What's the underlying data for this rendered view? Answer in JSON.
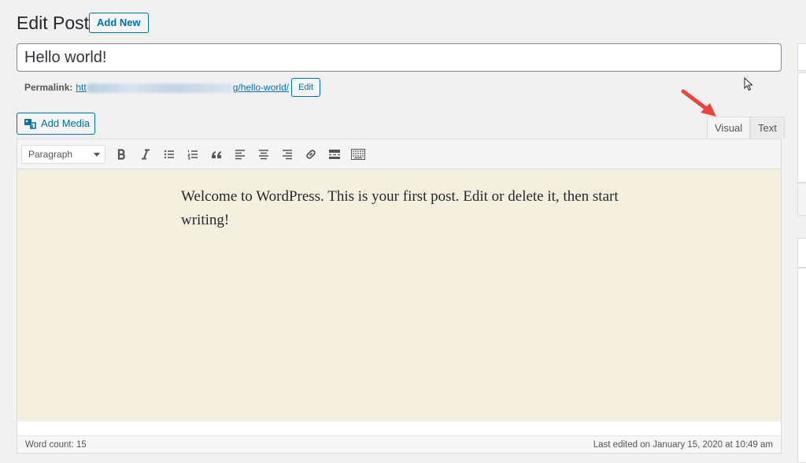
{
  "header": {
    "title": "Edit Post",
    "add_new_label": "Add New"
  },
  "post": {
    "title_value": "Hello world!",
    "permalink_label": "Permalink:",
    "permalink_prefix": "htt",
    "permalink_suffix": "g/hello-world/",
    "edit_slug_label": "Edit"
  },
  "editor": {
    "add_media_label": "Add Media",
    "tabs": [
      {
        "label": "Visual",
        "active": true
      },
      {
        "label": "Text",
        "active": false
      }
    ],
    "format_value": "Paragraph",
    "toolbar_icons": [
      "bold-icon",
      "italic-icon",
      "bulleted-list-icon",
      "numbered-list-icon",
      "blockquote-icon",
      "align-left-icon",
      "align-center-icon",
      "align-right-icon",
      "link-icon",
      "read-more-icon",
      "toolbar-toggle-icon"
    ],
    "content_text": "Welcome to WordPress. This is your first post. Edit or delete it, then start writing!",
    "word_count": "Word count: 15",
    "last_edited": "Last edited on January 15, 2020 at 10:49 am"
  },
  "colors": {
    "accent": "#0071a1",
    "content_bg": "#f5efe0",
    "annotation_arrow": "#e8453c"
  }
}
